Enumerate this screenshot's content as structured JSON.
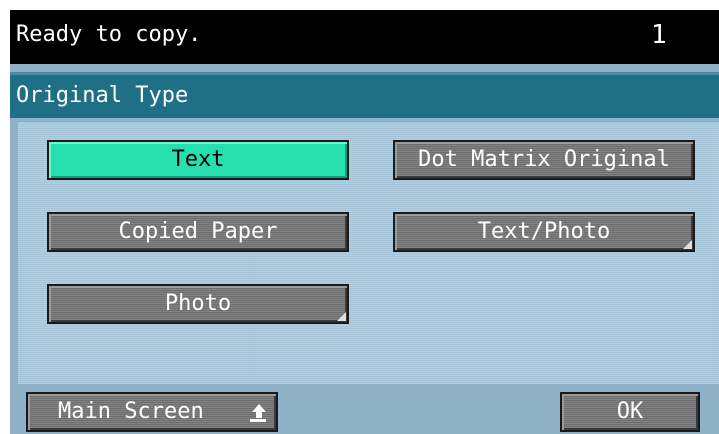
{
  "status": {
    "message": "Ready to copy.",
    "copy_count": "1"
  },
  "title": "Original Type",
  "options": {
    "text": "Text",
    "dot_matrix": "Dot Matrix Original",
    "copied_paper": "Copied Paper",
    "text_photo": "Text/Photo",
    "photo": "Photo"
  },
  "selected_option": "Text",
  "footer": {
    "main_screen": "Main Screen",
    "ok": "OK"
  },
  "icons": {
    "main_screen": "return-arrow-icon",
    "corner": "corner-tab-icon"
  },
  "colors": {
    "selected": "#26dfae",
    "button": "#6e6e6e",
    "title_bar": "#1f6f86",
    "panel": "#a5c4d8",
    "status_bar": "#000000"
  }
}
